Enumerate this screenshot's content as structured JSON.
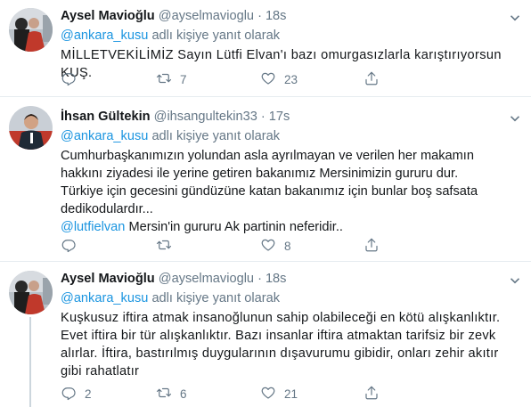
{
  "colors": {
    "accent": "#1b95e0",
    "muted": "#657786",
    "text": "#14171a",
    "divider": "#e6ecf0"
  },
  "tweets": [
    {
      "name": "Aysel Mavioğlu",
      "handle": "@ayselmavioglu",
      "separator": "·",
      "time": "18s",
      "replying_to": "@ankara_kusu",
      "replying_suffix": " adlı kişiye yanıt olarak",
      "text_lines": [
        "MİLLETVEKİLİMİZ Sayın  Lütfi Elvan'ı bazı omurgasızlarla karıştırıyorsun KUŞ."
      ],
      "replies": "",
      "retweets": "7",
      "likes": "23"
    },
    {
      "name": "İhsan Gültekin",
      "handle": "@ihsangultekin33",
      "separator": "·",
      "time": "17s",
      "replying_to": "@ankara_kusu",
      "replying_suffix": " adlı kişiye yanıt olarak",
      "text_lines": [
        "Cumhurbaşkanımızın yolundan asla ayrılmayan ve verilen her makamın",
        "hakkını ziyadesi ile yerine getiren bakanımız Mersinimizin gururu dur.",
        "Türkiye için gecesini gündüzüne katan bakanımız için bunlar boş safsata",
        "dedikodulardır..."
      ],
      "mention_line": "@lutfielvan",
      "mention_rest": " Mersin'in gururu Ak partinin neferidir..",
      "replies": "",
      "retweets": "",
      "likes": "8"
    },
    {
      "name": "Aysel Mavioğlu",
      "handle": "@ayselmavioglu",
      "separator": "·",
      "time": "18s",
      "replying_to": "@ankara_kusu",
      "replying_suffix": " adlı kişiye yanıt olarak",
      "text_lines": [
        "Kuşkusuz iftira atmak insanoğlunun sahip olabileceği en kötü alışkanlıktır.",
        "Evet iftira bir tür alışkanlıktır. Bazı insanlar iftira atmaktan tarifsiz bir zevk",
        "alırlar. İftira, bastırılmış duygularının dışavurumu gibidir, onları zehir akıtır",
        "gibi rahatlatır"
      ],
      "replies": "2",
      "retweets": "6",
      "likes": "21"
    }
  ]
}
